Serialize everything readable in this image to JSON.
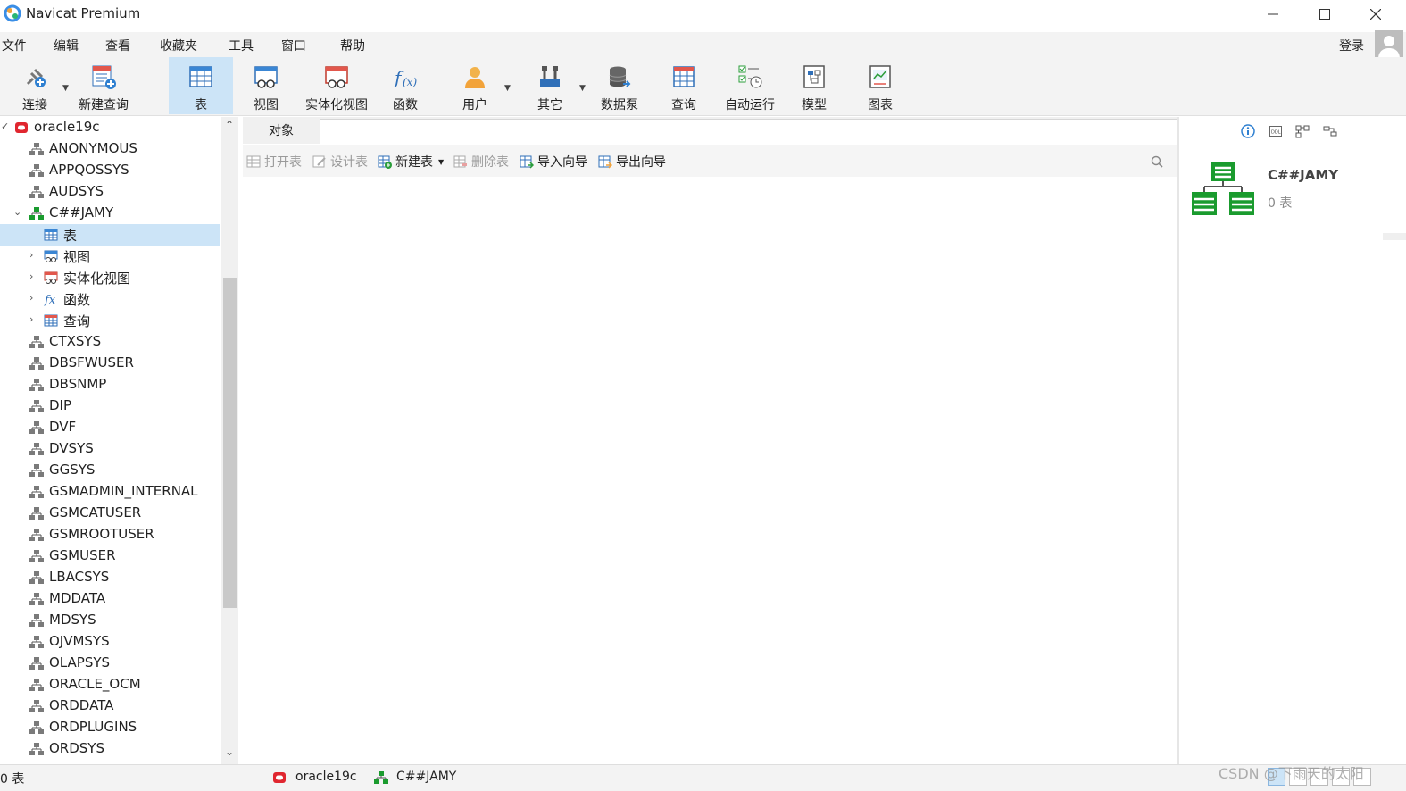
{
  "window": {
    "title": "Navicat Premium"
  },
  "menu": [
    "文件",
    "编辑",
    "查看",
    "收藏夹",
    "工具",
    "窗口",
    "帮助"
  ],
  "account": {
    "login_label": "登录"
  },
  "toolbar": {
    "connect": "连接",
    "new_query": "新建查询",
    "table": "表",
    "view": "视图",
    "mat_view": "实体化视图",
    "function": "函数",
    "user": "用户",
    "other": "其它",
    "data_pump": "数据泵",
    "query": "查询",
    "auto_run": "自动运行",
    "model": "模型",
    "chart": "图表"
  },
  "tree": {
    "connection": "oracle19c",
    "schemas_before": [
      "ANONYMOUS",
      "APPQOSSYS",
      "AUDSYS"
    ],
    "open_schema": "C##JAMY",
    "open_children": [
      "表",
      "视图",
      "实体化视图",
      "函数",
      "查询"
    ],
    "schemas_after": [
      "CTXSYS",
      "DBSFWUSER",
      "DBSNMP",
      "DIP",
      "DVF",
      "DVSYS",
      "GGSYS",
      "GSMADMIN_INTERNAL",
      "GSMCATUSER",
      "GSMROOTUSER",
      "GSMUSER",
      "LBACSYS",
      "MDDATA",
      "MDSYS",
      "OJVMSYS",
      "OLAPSYS",
      "ORACLE_OCM",
      "ORDDATA",
      "ORDPLUGINS",
      "ORDSYS"
    ]
  },
  "main": {
    "tab_label": "对象",
    "open_table": "打开表",
    "design_table": "设计表",
    "new_table": "新建表",
    "delete_table": "删除表",
    "import_wizard": "导入向导",
    "export_wizard": "导出向导"
  },
  "info": {
    "schema_name": "C##JAMY",
    "table_count": "0 表"
  },
  "status": {
    "count": "0 表",
    "connection": "oracle19c",
    "schema": "C##JAMY"
  },
  "watermark": "CSDN @下雨天的太阳",
  "colors": {
    "accent": "#cce4f7",
    "schema_green": "#1a9b2e",
    "oracle_red": "#e0262f"
  }
}
